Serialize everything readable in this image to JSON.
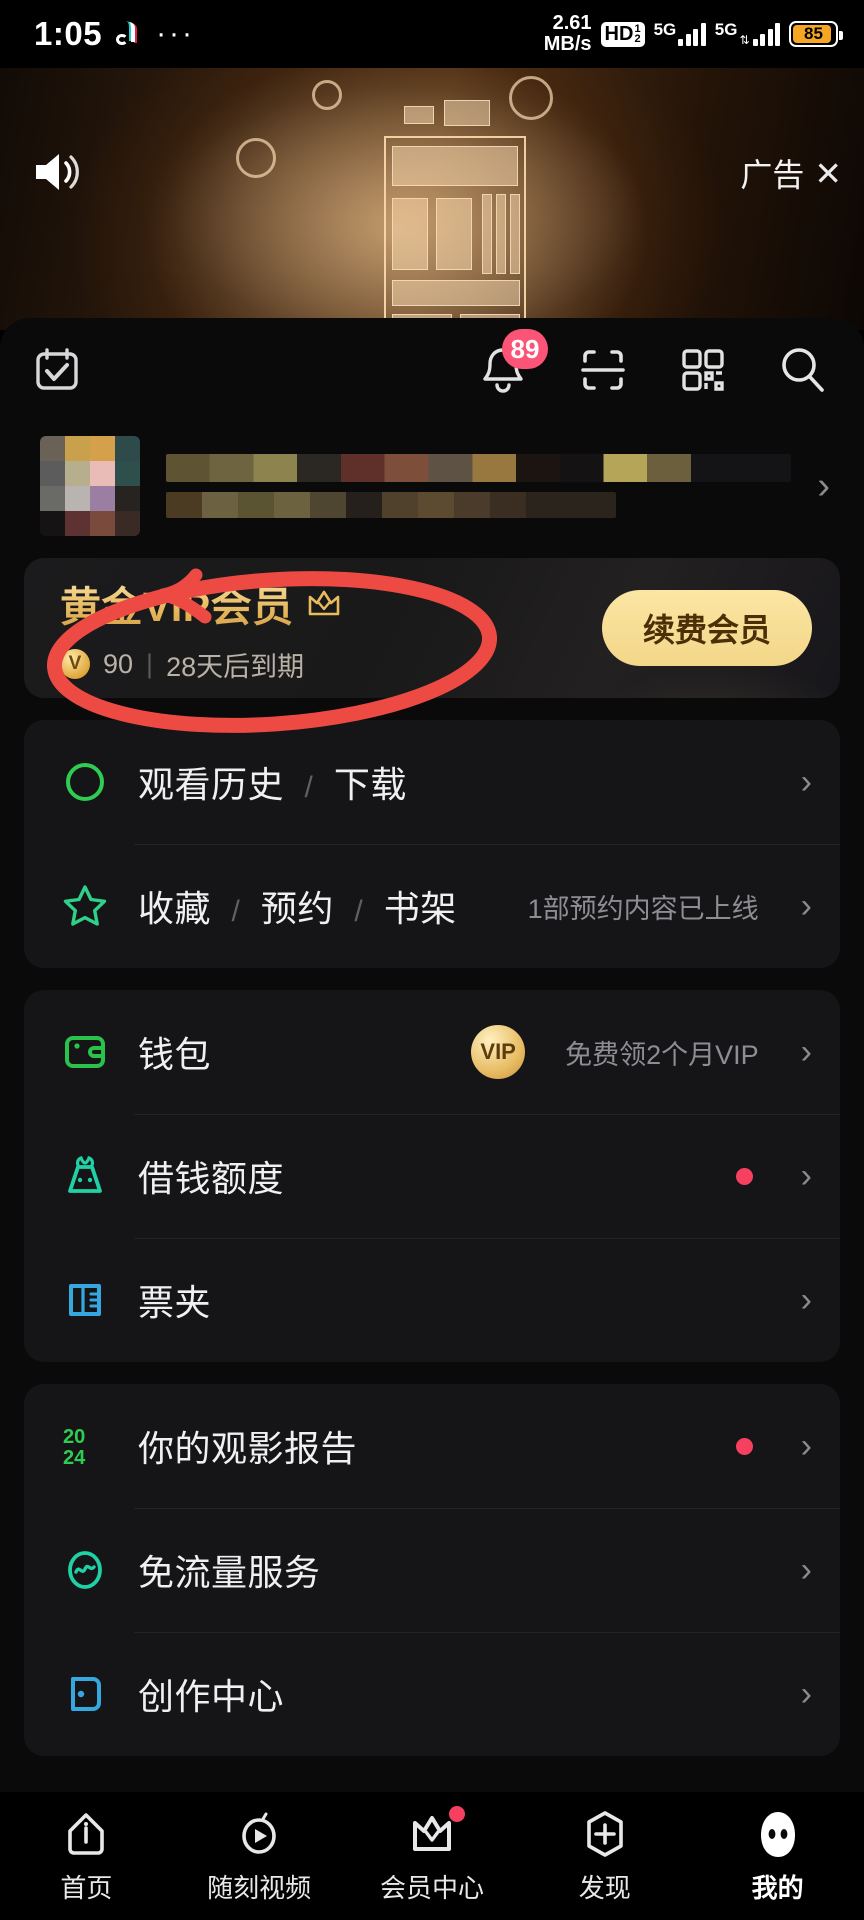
{
  "statusbar": {
    "time": "1:05",
    "app_icon": "tiktok-icon",
    "more": "···",
    "network_speed": "2.61",
    "network_speed_unit": "MB/s",
    "hd_badge": "HD",
    "hd_num": "1",
    "hd_den": "2",
    "sim1_network": "5G",
    "sim2_network": "5G",
    "battery_percent": "85"
  },
  "ad": {
    "label": "广告",
    "close": "✕",
    "sound_icon": "speaker-icon"
  },
  "toolbar": {
    "checkin_icon": "calendar-check-icon",
    "bell_icon": "bell-icon",
    "bell_badge": "89",
    "scan_icon": "scan-frame-icon",
    "qr_icon": "qr-code-icon",
    "search_icon": "search-icon"
  },
  "profile": {
    "avatar": "blurred-avatar",
    "name": "",
    "subtitle": "",
    "chevron": "›"
  },
  "vip": {
    "title": "黄金VIP会员",
    "crown_icon": "crown-icon",
    "coins": "90",
    "coin_icon": "v-coin-icon",
    "separator": "|",
    "expiry": "28天后到期",
    "renew_label": "续费会员"
  },
  "groups": [
    {
      "rows": [
        {
          "icon": "history-circle-icon",
          "icon_color": "#2fcc52",
          "label_parts": [
            "观看历史",
            "/",
            "下载"
          ],
          "note": "",
          "badge": "",
          "dot": false,
          "chevron": "›"
        },
        {
          "icon": "star-icon",
          "icon_color": "#2fd08a",
          "label_parts": [
            "收藏",
            "/",
            "预约",
            "/",
            "书架"
          ],
          "note": "1部预约内容已上线",
          "badge": "",
          "dot": false,
          "chevron": "›"
        }
      ]
    },
    {
      "rows": [
        {
          "icon": "wallet-icon",
          "icon_color": "#29c24a",
          "label_parts": [
            "钱包"
          ],
          "note": "免费领2个月VIP",
          "badge": "VIP",
          "dot": false,
          "chevron": "›"
        },
        {
          "icon": "money-bag-icon",
          "icon_color": "#1fd1a5",
          "label_parts": [
            "借钱额度"
          ],
          "note": "",
          "badge": "",
          "dot": true,
          "chevron": "›"
        },
        {
          "icon": "ticket-icon",
          "icon_color": "#35a8e0",
          "label_parts": [
            "票夹"
          ],
          "note": "",
          "badge": "",
          "dot": false,
          "chevron": "›"
        }
      ]
    },
    {
      "rows": [
        {
          "icon": "year-2024-icon",
          "icon_color": "#2fcc52",
          "label_parts": [
            "你的观影报告"
          ],
          "note": "",
          "badge": "",
          "dot": true,
          "chevron": "›"
        },
        {
          "icon": "free-data-icon",
          "icon_color": "#1fd1a5",
          "label_parts": [
            "免流量服务"
          ],
          "note": "",
          "badge": "",
          "dot": false,
          "chevron": "›"
        },
        {
          "icon": "creator-center-icon",
          "icon_color": "#35a8e0",
          "label_parts": [
            "创作中心"
          ],
          "note": "",
          "badge": "",
          "dot": false,
          "chevron": "›"
        }
      ]
    }
  ],
  "bottom_nav": [
    {
      "label": "首页",
      "icon": "home-icon",
      "active": false,
      "dot": false
    },
    {
      "label": "随刻视频",
      "icon": "play-circle-icon",
      "active": false,
      "dot": false
    },
    {
      "label": "会员中心",
      "icon": "crown-nav-icon",
      "active": false,
      "dot": true
    },
    {
      "label": "发现",
      "icon": "plus-shield-icon",
      "active": false,
      "dot": false
    },
    {
      "label": "我的",
      "icon": "profile-face-icon",
      "active": true,
      "dot": false
    }
  ],
  "annotation": {
    "type": "red-ellipse-highlight",
    "color": "#ee4a44",
    "target": "观看历史 / 下载"
  }
}
